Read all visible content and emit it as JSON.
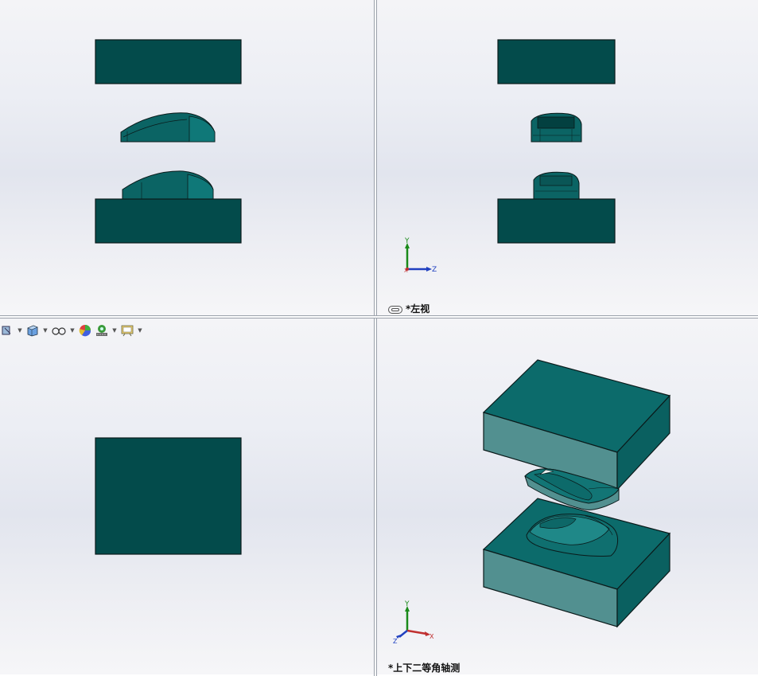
{
  "viewports": {
    "left_view": {
      "label": "*左视"
    },
    "iso_view": {
      "label": "*上下二等角轴测"
    }
  },
  "axes": {
    "left_view": {
      "y": "Y",
      "z": "Z",
      "x": "X"
    },
    "iso_view": {
      "y": "Y",
      "z": "Z",
      "x": "X"
    }
  },
  "toolbar": {
    "icons": [
      "section-view-icon",
      "view-orientation-icon",
      "display-style-icon",
      "hide-show-items-icon",
      "edit-appearance-icon",
      "apply-scene-icon",
      "view-settings-icon"
    ]
  },
  "colors": {
    "part_dark": "#034b4b",
    "part_top": "#0c6b6b",
    "part_side": "#529090",
    "edge": "#0a1a1a"
  }
}
